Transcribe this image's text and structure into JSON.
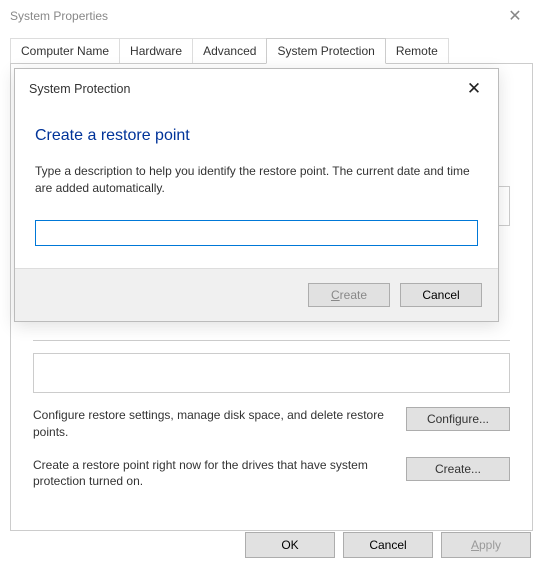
{
  "window": {
    "title": "System Properties"
  },
  "tabs": {
    "items": [
      {
        "label": "Computer Name"
      },
      {
        "label": "Hardware"
      },
      {
        "label": "Advanced"
      },
      {
        "label": "System Protection"
      },
      {
        "label": "Remote"
      }
    ]
  },
  "background": {
    "configure_text": "Configure restore settings, manage disk space, and delete restore points.",
    "configure_btn": "Configure...",
    "create_text": "Create a restore point right now for the drives that have system protection turned on.",
    "create_btn": "Create..."
  },
  "dialog": {
    "title": "System Protection",
    "heading": "Create a restore point",
    "description": "Type a description to help you identify the restore point. The current date and time are added automatically.",
    "input_value": "",
    "create_btn": "Create",
    "cancel_btn": "Cancel"
  },
  "buttons": {
    "ok": "OK",
    "cancel": "Cancel",
    "apply": "Apply"
  }
}
